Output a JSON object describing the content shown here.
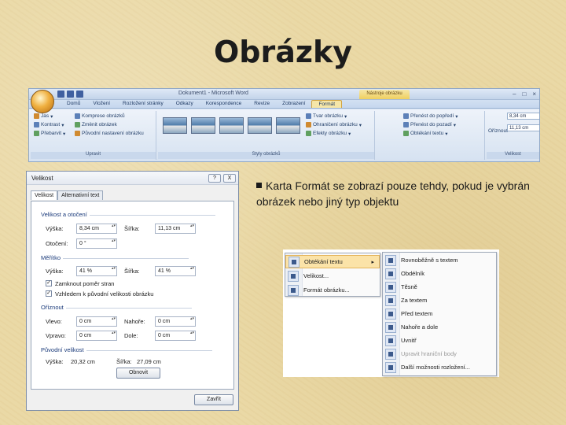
{
  "slide": {
    "title": "Obrázky",
    "body_text": "Karta Formát se zobrazí pouze tehdy, pokud je vybrán obrázek nebo jiný typ objektu"
  },
  "ribbon": {
    "window_title": "Dokument1 - Microsoft Word",
    "context_title": "Nástroje obrázku",
    "tabs": [
      "Domů",
      "Vložení",
      "Rozložení stránky",
      "Odkazy",
      "Korespondence",
      "Revize",
      "Zobrazení",
      "Formát"
    ],
    "active_tab": "Formát",
    "groups": {
      "upravit": {
        "caption": "Upravit",
        "items": [
          "Jas",
          "Kontrast",
          "Přebarvit",
          "Komprese obrázků",
          "Změnit obrázek",
          "Původní nastavení obrázku"
        ]
      },
      "styly": {
        "caption": "Styly obrázků",
        "items": [
          "Tvar obrázku",
          "Ohraničení obrázku",
          "Efekty obrázku"
        ]
      },
      "uspor": {
        "items": [
          "Přenést do popředí",
          "Přenést do pozadí",
          "Obtékání textu"
        ]
      },
      "velikost": {
        "caption": "Velikost",
        "crop_label": "Oříznout",
        "height": "8,34 cm",
        "width": "11,13 cm"
      }
    }
  },
  "dialog": {
    "title": "Velikost",
    "help": "?",
    "close": "X",
    "tabs": [
      "Velikost",
      "Alternativní text"
    ],
    "sections": {
      "size_rotate": "Velikost a otočení",
      "scale": "Měřítko",
      "crop": "Oříznout",
      "original": "Původní velikost"
    },
    "labels": {
      "height": "Výška:",
      "width": "Šířka:",
      "rotation": "Otočení:",
      "left": "Vlevo:",
      "right": "Vpravo:",
      "top": "Nahoře:",
      "bottom": "Dole:",
      "lock_aspect": "Zamknout poměr stran",
      "relative": "Vzhledem k původní velikosti obrázku",
      "orig_height": "Výška:",
      "orig_width": "Šířka:"
    },
    "values": {
      "height": "8,34 cm",
      "width": "11,13 cm",
      "rotation": "0 °",
      "scale_height": "41 %",
      "scale_width": "41 %",
      "crop_left": "0 cm",
      "crop_right": "0 cm",
      "crop_top": "0 cm",
      "crop_bottom": "0 cm",
      "orig_height": "20,32 cm",
      "orig_width": "27,09 cm"
    },
    "reset_button": "Obnovit",
    "close_button": "Zavřít"
  },
  "menus": {
    "primary": [
      {
        "label": "Obtékání textu",
        "highlight": true,
        "submenu": true
      },
      {
        "label": "Velikost...",
        "highlight": false
      },
      {
        "label": "Formát obrázku...",
        "highlight": false
      }
    ],
    "wrap": [
      {
        "label": "Rovnoběžně s textem",
        "disabled": false
      },
      {
        "label": "Obdélník",
        "disabled": false
      },
      {
        "label": "Těsně",
        "disabled": false
      },
      {
        "label": "Za textem",
        "disabled": false
      },
      {
        "label": "Před textem",
        "disabled": false
      },
      {
        "label": "Nahoře a dole",
        "disabled": false
      },
      {
        "label": "Uvnitř",
        "disabled": false
      },
      {
        "label": "Upravit hraniční body",
        "disabled": true
      },
      {
        "label": "Další možnosti rozložení...",
        "disabled": false
      }
    ]
  }
}
